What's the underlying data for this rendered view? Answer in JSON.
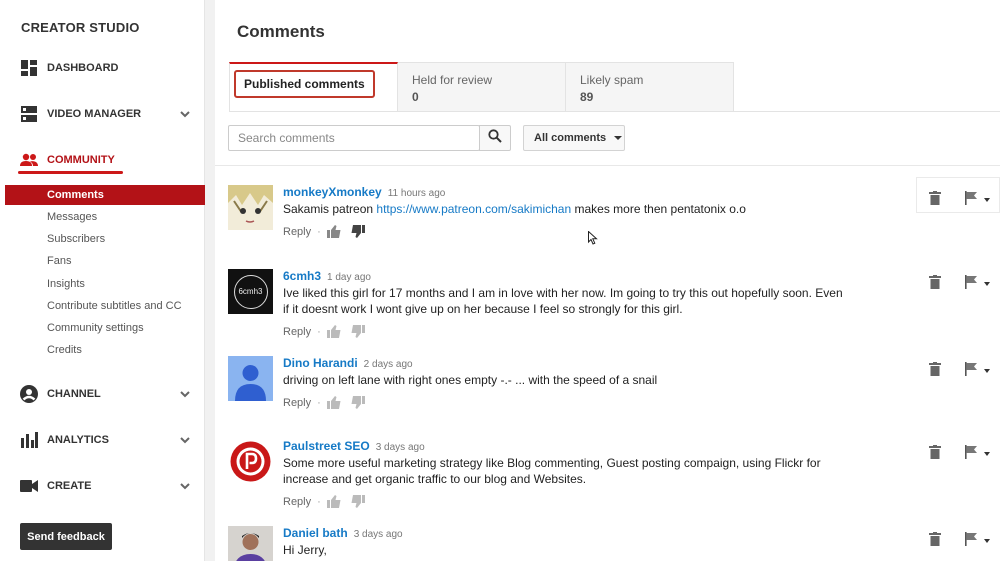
{
  "sidebar": {
    "title": "CREATOR STUDIO",
    "nav": [
      {
        "label": "DASHBOARD",
        "icon": "dashboard-icon"
      },
      {
        "label": "VIDEO MANAGER",
        "icon": "video-manager-icon"
      },
      {
        "label": "COMMUNITY",
        "icon": "community-icon"
      },
      {
        "label": "CHANNEL",
        "icon": "channel-icon"
      },
      {
        "label": "ANALYTICS",
        "icon": "analytics-icon"
      },
      {
        "label": "CREATE",
        "icon": "create-icon"
      }
    ],
    "community_items": [
      "Comments",
      "Messages",
      "Subscribers",
      "Fans",
      "Insights",
      "Contribute subtitles and CC",
      "Community settings",
      "Credits"
    ],
    "feedback_label": "Send feedback"
  },
  "main": {
    "title": "Comments",
    "tabs": [
      {
        "label": "Published comments",
        "count": ""
      },
      {
        "label": "Held for review",
        "count": "0"
      },
      {
        "label": "Likely spam",
        "count": "89"
      }
    ],
    "search_placeholder": "Search comments",
    "filter_label": "All comments"
  },
  "comments": [
    {
      "author": "monkeyXmonkey",
      "time": "11 hours ago",
      "text_before": "Sakamis patreon ",
      "link": "https://www.patreon.com/sakimichan",
      "text_after": " makes more then pentatonix o.o",
      "reply": "Reply"
    },
    {
      "author": "6cmh3",
      "time": "1 day ago",
      "text": "Ive liked this girl for 17 months and I am in love with her now. Im going to try this out hopefully soon. Even if it doesnt work I wont give up on her because I feel so strongly for this girl.",
      "reply": "Reply",
      "avatar_text": "6cmh3"
    },
    {
      "author": "Dino Harandi",
      "time": "2 days ago",
      "text": "driving on left lane with right ones empty -.-  ... with the speed of a snail",
      "reply": "Reply"
    },
    {
      "author": "Paulstreet SEO",
      "time": "3 days ago",
      "text": "Some more useful marketing strategy like Blog commenting, Guest posting compaign, using Flickr for increase and get organic traffic to our blog and Websites.",
      "reply": "Reply"
    },
    {
      "author": "Daniel bath",
      "time": "3 days ago",
      "text": "Hi Jerry,"
    }
  ],
  "colors": {
    "accent": "#b31217",
    "link": "#167ac6"
  }
}
